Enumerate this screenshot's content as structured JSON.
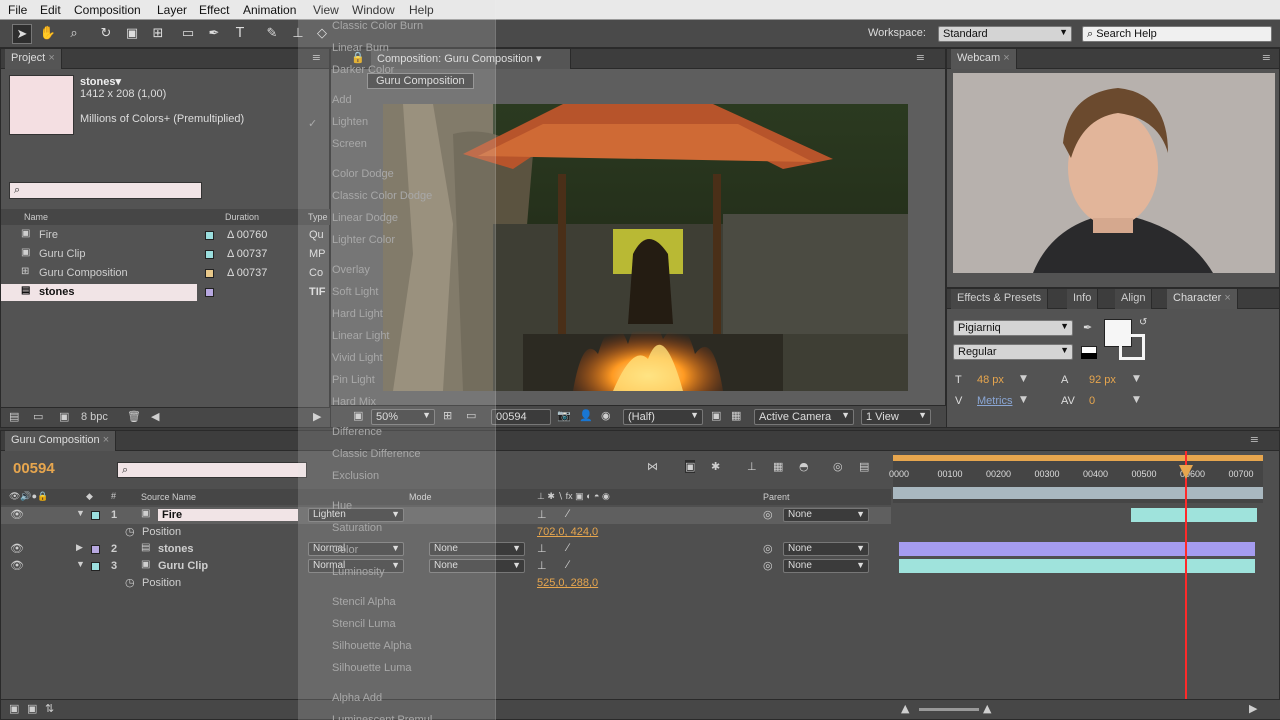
{
  "menu": [
    "File",
    "Edit",
    "Composition",
    "Layer",
    "Effect",
    "Animation",
    "View",
    "Window",
    "Help"
  ],
  "workspace": {
    "label": "Workspace:",
    "value": "Standard",
    "search_placeholder": "Search Help"
  },
  "project": {
    "tab": "Project",
    "thumb_name": "stones▾",
    "thumb_dims": "1412 x 208 (1,00)",
    "thumb_colors": "Millions of Colors+ (Premultiplied)",
    "cols": {
      "name": "Name",
      "duration": "Duration",
      "type": "Type"
    },
    "items": [
      {
        "name": "Fire",
        "duration": "Δ 00760",
        "type": "Qu",
        "color": "#9bdede"
      },
      {
        "name": "Guru Clip",
        "duration": "Δ 00737",
        "type": "MP",
        "color": "#9bdede"
      },
      {
        "name": "Guru Composition",
        "duration": "Δ 00737",
        "type": "Co",
        "color": "#e8c88a"
      },
      {
        "name": "stones",
        "duration": "",
        "type": "TIF",
        "color": "#b7a8e0"
      }
    ],
    "bpc": "8 bpc"
  },
  "composition": {
    "tab": "Composition: Guru Composition",
    "subtab": "Guru Composition",
    "zoom": "50%",
    "timecode": "00594",
    "resolution": "(Half)",
    "camera": "Active Camera",
    "views": "1 View"
  },
  "webcam": {
    "tab": "Webcam"
  },
  "character": {
    "tabs": [
      "Effects & Presets",
      "Info",
      "Align",
      "Character"
    ],
    "font": "Pigiarniq",
    "style": "Regular",
    "size": "48 px",
    "leading": "92 px",
    "kerning": "Metrics",
    "tracking": "0"
  },
  "timeline": {
    "tab": "Guru Composition",
    "timecode": "00594",
    "cols": {
      "source": "Source Name",
      "mode": "Mode",
      "parent": "Parent"
    },
    "ruler": [
      "0000",
      "00100",
      "00200",
      "00300",
      "00400",
      "00500",
      "00600",
      "00700"
    ],
    "layers": [
      {
        "num": "1",
        "name": "Fire",
        "mode": "Lighten",
        "trkmat": "",
        "parent": "None",
        "color": "#9bdede"
      },
      {
        "num": "2",
        "name": "stones",
        "mode": "Normal",
        "trkmat": "None",
        "parent": "None",
        "color": "#b7a8e0"
      },
      {
        "num": "3",
        "name": "Guru Clip",
        "mode": "Normal",
        "trkmat": "None",
        "parent": "None",
        "color": "#9bdede"
      }
    ],
    "position_label": "Position",
    "fire_position": "702,0, 424,0",
    "clip_position": "525,0, 288,0"
  },
  "blend_menu": [
    "Classic Color Burn",
    "Linear Burn",
    "Darker Color",
    "Add",
    "Lighten",
    "Screen",
    "Color Dodge",
    "Classic Color Dodge",
    "Linear Dodge",
    "Lighter Color",
    "Overlay",
    "Soft Light",
    "Hard Light",
    "Linear Light",
    "Vivid Light",
    "Pin Light",
    "Hard Mix",
    "Difference",
    "Classic Difference",
    "Exclusion",
    "Hue",
    "Saturation",
    "Color",
    "Luminosity",
    "Stencil Alpha",
    "Stencil Luma",
    "Silhouette Alpha",
    "Silhouette Luma",
    "Alpha Add",
    "Luminescent Premul"
  ]
}
